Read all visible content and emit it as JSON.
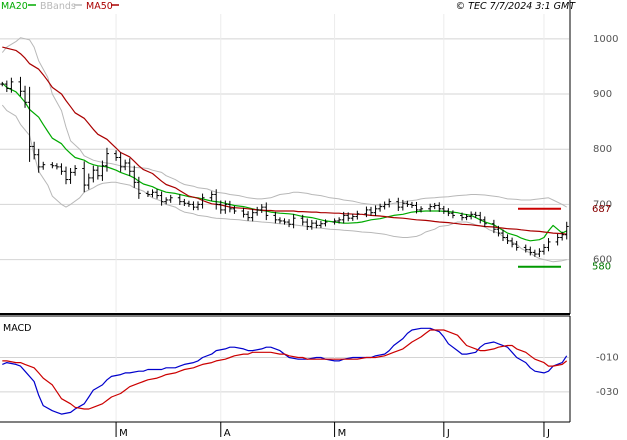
{
  "chart_data": [
    {
      "type": "ohlc",
      "legend": [
        {
          "label": "MA20",
          "color": "#00aa00"
        },
        {
          "label": "BBands",
          "color": "#b8b8b8"
        },
        {
          "label": "MA50",
          "color": "#aa0000"
        }
      ],
      "timestamp": "© TEC 7/7/2024 3:1 GMT",
      "ylim": [
        505,
        1045
      ],
      "y_ticks": [
        {
          "value": 1000,
          "label": "1000"
        },
        {
          "value": 900,
          "label": "900"
        },
        {
          "value": 800,
          "label": "800"
        },
        {
          "value": 700,
          "label": "700"
        },
        {
          "value": 600,
          "label": "600"
        }
      ],
      "x_labels": [
        {
          "index": 25,
          "label": "M"
        },
        {
          "index": 48,
          "label": "A"
        },
        {
          "index": 73,
          "label": "M"
        },
        {
          "index": 97,
          "label": "J"
        },
        {
          "index": 119,
          "label": "J"
        }
      ],
      "markers": [
        {
          "label": "687",
          "value": 692,
          "color": "#cc0000",
          "label_color": "#880000"
        },
        {
          "label": "580",
          "value": 587,
          "color": "#009900",
          "label_color": "#007700"
        }
      ],
      "x_count": 125,
      "close": [
        918,
        910,
        922,
        905,
        885,
        805,
        790,
        768,
        772,
        770,
        768,
        760,
        745,
        758,
        765,
        735,
        748,
        762,
        752,
        770,
        792,
        785,
        768,
        775,
        760,
        740,
        720,
        718,
        722,
        716,
        705,
        708,
        712,
        705,
        702,
        700,
        695,
        700,
        712,
        718,
        700,
        690,
        700,
        692,
        688,
        682,
        676,
        685,
        690,
        695,
        680,
        672,
        670,
        668,
        664,
        675,
        668,
        660,
        666,
        662,
        665,
        668,
        670,
        672,
        680,
        675,
        678,
        683,
        690,
        685,
        692,
        696,
        700,
        705,
        695,
        702,
        700,
        698,
        690,
        692,
        696,
        698,
        692,
        688,
        684,
        680,
        676,
        678,
        682,
        680,
        672,
        665,
        655,
        648,
        640,
        634,
        628,
        622,
        618,
        613,
        610,
        615,
        622,
        632,
        640,
        645,
        660
      ],
      "series": [
        {
          "name": "MA20",
          "color": "#00aa00",
          "values": [
            920,
            912,
            904,
            895,
            885,
            872,
            858,
            845,
            832,
            820,
            810,
            800,
            792,
            785,
            780,
            775,
            772,
            770,
            768,
            765,
            762,
            758,
            752,
            748,
            742,
            737,
            732,
            728,
            725,
            722,
            720,
            718,
            716,
            714,
            712,
            710,
            708,
            706,
            704,
            702,
            700,
            698,
            696,
            694,
            692,
            690,
            688,
            686,
            685,
            684,
            683,
            682,
            680,
            678,
            676,
            674,
            672,
            670,
            668,
            667,
            666,
            666,
            667,
            668,
            670,
            672,
            674,
            676,
            678,
            680,
            682,
            684,
            686,
            687,
            688,
            688,
            688,
            688,
            687,
            686,
            685,
            683,
            680,
            676,
            672,
            668,
            663,
            658,
            653,
            648,
            643,
            639,
            636,
            634,
            636,
            640,
            652,
            662,
            648,
            652
          ]
        },
        {
          "name": "MA50",
          "color": "#aa0000",
          "values": [
            985,
            983,
            979,
            973,
            965,
            955,
            945,
            935,
            924,
            912,
            900,
            888,
            877,
            866,
            856,
            846,
            836,
            827,
            818,
            810,
            802,
            794,
            786,
            778,
            770,
            763,
            756,
            749,
            742,
            736,
            730,
            725,
            720,
            715,
            711,
            707,
            704,
            701,
            699,
            697,
            695,
            694,
            693,
            692,
            691,
            690,
            689,
            689,
            688,
            688,
            688,
            688,
            687,
            687,
            686,
            686,
            685,
            685,
            684,
            684,
            683,
            683,
            682,
            682,
            681,
            680,
            679,
            678,
            677,
            676,
            675,
            674,
            673,
            672,
            671,
            670,
            669,
            668,
            667,
            666,
            665,
            664,
            663,
            662,
            661,
            660,
            659,
            658,
            657,
            656,
            655,
            654,
            653,
            652,
            651,
            650,
            649,
            648,
            647,
            646
          ]
        },
        {
          "name": "BBands upper",
          "color": "#b8b8b8",
          "values": [
            975,
            985,
            995,
            1002,
            998,
            985,
            960,
            930,
            900,
            870,
            840,
            815,
            800,
            788,
            780,
            778,
            776,
            774,
            772,
            770,
            768,
            767,
            766,
            765,
            762,
            758,
            752,
            745,
            740,
            736,
            733,
            730,
            728,
            725,
            722,
            720,
            718,
            716,
            714,
            712,
            710,
            710,
            712,
            715,
            718,
            720,
            722,
            722,
            720,
            718,
            716,
            714,
            712,
            710,
            708,
            706,
            704,
            702,
            700,
            699,
            699,
            700,
            702,
            704,
            706,
            708,
            710,
            711,
            712,
            713,
            714,
            715,
            716,
            717,
            718,
            718,
            717,
            716,
            714,
            712,
            710,
            709,
            708,
            708,
            709,
            710,
            712,
            708,
            700,
            695
          ]
        },
        {
          "name": "BBands lower",
          "color": "#b8b8b8",
          "values": [
            880,
            870,
            860,
            845,
            825,
            790,
            760,
            735,
            715,
            700,
            695,
            700,
            712,
            722,
            730,
            735,
            738,
            740,
            740,
            738,
            735,
            730,
            724,
            718,
            712,
            706,
            700,
            695,
            690,
            686,
            683,
            680,
            678,
            676,
            675,
            674,
            673,
            672,
            671,
            670,
            669,
            668,
            667,
            666,
            665,
            664,
            663,
            662,
            660,
            658,
            657,
            656,
            655,
            654,
            653,
            652,
            651,
            650,
            649,
            648,
            646,
            644,
            642,
            640,
            640,
            642,
            645,
            650,
            655,
            660,
            662,
            665,
            668,
            668,
            666,
            663,
            659,
            654,
            648,
            642,
            635,
            628,
            620,
            612,
            606,
            602,
            598,
            596,
            598,
            600
          ]
        }
      ]
    },
    {
      "type": "line",
      "title": "MACD",
      "ylim": [
        -47,
        13
      ],
      "y_ticks": [
        {
          "value": -10,
          "label": "-010"
        },
        {
          "value": -30,
          "label": "-030"
        }
      ],
      "series": [
        {
          "name": "MACD",
          "color": "#0000cc",
          "values": [
            -14,
            -13,
            -14,
            -15,
            -18,
            -24,
            -32,
            -38,
            -41,
            -42,
            -43,
            -42,
            -40,
            -37,
            -33,
            -29,
            -26,
            -23,
            -21,
            -20,
            -19,
            -19,
            -18,
            -18,
            -17,
            -17,
            -17,
            -16,
            -16,
            -15,
            -14,
            -13,
            -12,
            -10,
            -8,
            -6,
            -5,
            -4,
            -4,
            -5,
            -6,
            -6,
            -5,
            -4,
            -4,
            -6,
            -8,
            -10,
            -11,
            -11,
            -11,
            -10,
            -10,
            -11,
            -12,
            -12,
            -11,
            -10,
            -10,
            -10,
            -10,
            -9,
            -8,
            -6,
            -3,
            1,
            4,
            6,
            7,
            7,
            7,
            5,
            2,
            -2,
            -6,
            -8,
            -8,
            -7,
            -4,
            -2,
            -1,
            -2,
            -4,
            -7,
            -10,
            -13,
            -16,
            -18,
            -19,
            -18,
            -15,
            -13,
            -9
          ]
        },
        {
          "name": "Signal",
          "color": "#cc0000",
          "values": [
            -12,
            -12,
            -13,
            -13,
            -14,
            -16,
            -19,
            -22,
            -26,
            -30,
            -34,
            -37,
            -39,
            -40,
            -40,
            -39,
            -37,
            -35,
            -33,
            -31,
            -29,
            -27,
            -25,
            -24,
            -23,
            -22,
            -21,
            -20,
            -19,
            -18,
            -17,
            -16,
            -15,
            -14,
            -13,
            -12,
            -11,
            -10,
            -9,
            -8,
            -8,
            -7,
            -7,
            -7,
            -7,
            -8,
            -8,
            -9,
            -10,
            -10,
            -11,
            -11,
            -11,
            -11,
            -11,
            -11,
            -11,
            -11,
            -11,
            -10,
            -10,
            -10,
            -9,
            -8,
            -7,
            -5,
            -3,
            -1,
            2,
            4,
            6,
            6,
            6,
            5,
            3,
            0,
            -3,
            -5,
            -6,
            -6,
            -5,
            -4,
            -3,
            -3,
            -5,
            -7,
            -9,
            -11,
            -13,
            -15,
            -15,
            -14,
            -12
          ]
        }
      ]
    }
  ]
}
